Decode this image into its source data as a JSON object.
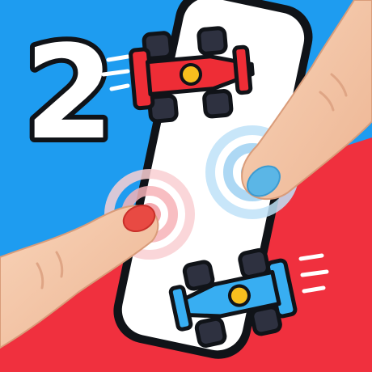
{
  "app_icon": {
    "player_count_label": "2"
  },
  "colors": {
    "blue_background": "#1E9CF0",
    "red_background": "#F0303E",
    "phone_screen": "#FFFFFF",
    "phone_frame": "#101318",
    "red_car": "#EE2D36",
    "blue_car": "#38AEF2",
    "car_accent": "#F7BE1E",
    "tire": "#2E3140",
    "skin": "#F5C6A7",
    "nail_blue": "#5BB6E6",
    "nail_red": "#E84A43"
  },
  "icons": [
    "red-race-car-icon",
    "blue-race-car-icon",
    "speed-lines-icon",
    "touch-ripple-icon",
    "finger-icon"
  ]
}
